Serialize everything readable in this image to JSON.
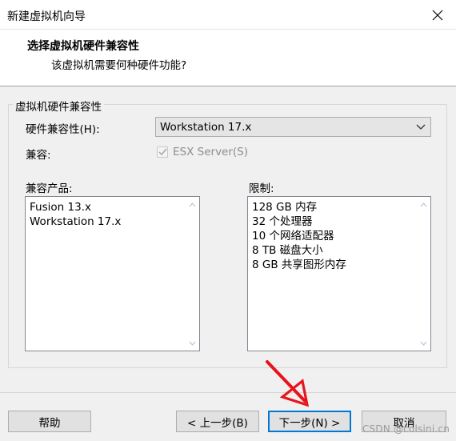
{
  "window": {
    "title": "新建虚拟机向导",
    "close_icon": "close-icon"
  },
  "header": {
    "title": "选择虚拟机硬件兼容性",
    "subtitle": "该虚拟机需要何种硬件功能?"
  },
  "group": {
    "label": "虚拟机硬件兼容性",
    "hw_compat_label": "硬件兼容性(H):",
    "hw_compat_value": "Workstation 17.x",
    "compat_label": "兼容:",
    "esx_checkbox_label": "ESX Server(S)",
    "esx_checked": true,
    "esx_disabled": true
  },
  "products": {
    "label": "兼容产品:",
    "items": [
      "Fusion 13.x",
      "Workstation 17.x"
    ]
  },
  "limits": {
    "label": "限制:",
    "items": [
      "128 GB 内存",
      "32 个处理器",
      "10 个网络适配器",
      "8 TB 磁盘大小",
      "8 GB 共享图形内存"
    ]
  },
  "buttons": {
    "help": "帮助",
    "back": "< 上一步(B)",
    "next": "下一步(N) >",
    "cancel": "取消"
  },
  "watermark": "CSDN @colsini.cn",
  "colors": {
    "accent": "#0078d7",
    "annotation_arrow": "#e8141c"
  }
}
